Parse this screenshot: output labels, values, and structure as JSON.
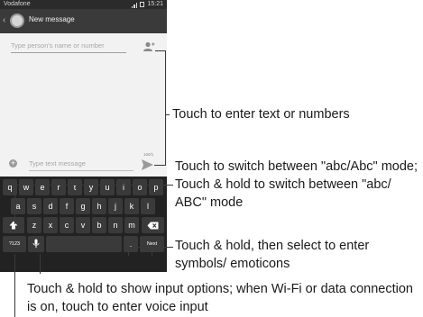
{
  "status_bar": {
    "carrier": "Vodafone",
    "time": "15:21"
  },
  "action_bar": {
    "title": "New message"
  },
  "recipient": {
    "placeholder": "Type person's name or number"
  },
  "compose": {
    "placeholder": "Type text message",
    "counter": "160/1"
  },
  "keyboard": {
    "row1": [
      "q",
      "w",
      "e",
      "r",
      "t",
      "y",
      "u",
      "i",
      "o",
      "p"
    ],
    "row2": [
      "a",
      "s",
      "d",
      "f",
      "g",
      "h",
      "j",
      "k",
      "l"
    ],
    "row3": [
      "z",
      "x",
      "c",
      "v",
      "b",
      "n",
      "m"
    ],
    "symbols_key": "?123",
    "period_key": ".",
    "next_key": "Next"
  },
  "annotations": {
    "enter_text": "Touch to enter text or numbers",
    "abc_mode": "Touch to switch  between \"abc/Abc\" mode; Touch & hold to switch between \"abc/ ABC\" mode",
    "symbols": "Touch & hold, then select to enter symbols/ emoticons",
    "input_options": "Touch & hold to show input options; when Wi-Fi or data connection is on, touch to enter voice input"
  },
  "colors": {
    "status_bar": "#2b2b2b",
    "action_bar": "#3a3a3a",
    "keyboard": "#222222",
    "key": "#3a3a3a",
    "screen": "#f2f2f2"
  }
}
